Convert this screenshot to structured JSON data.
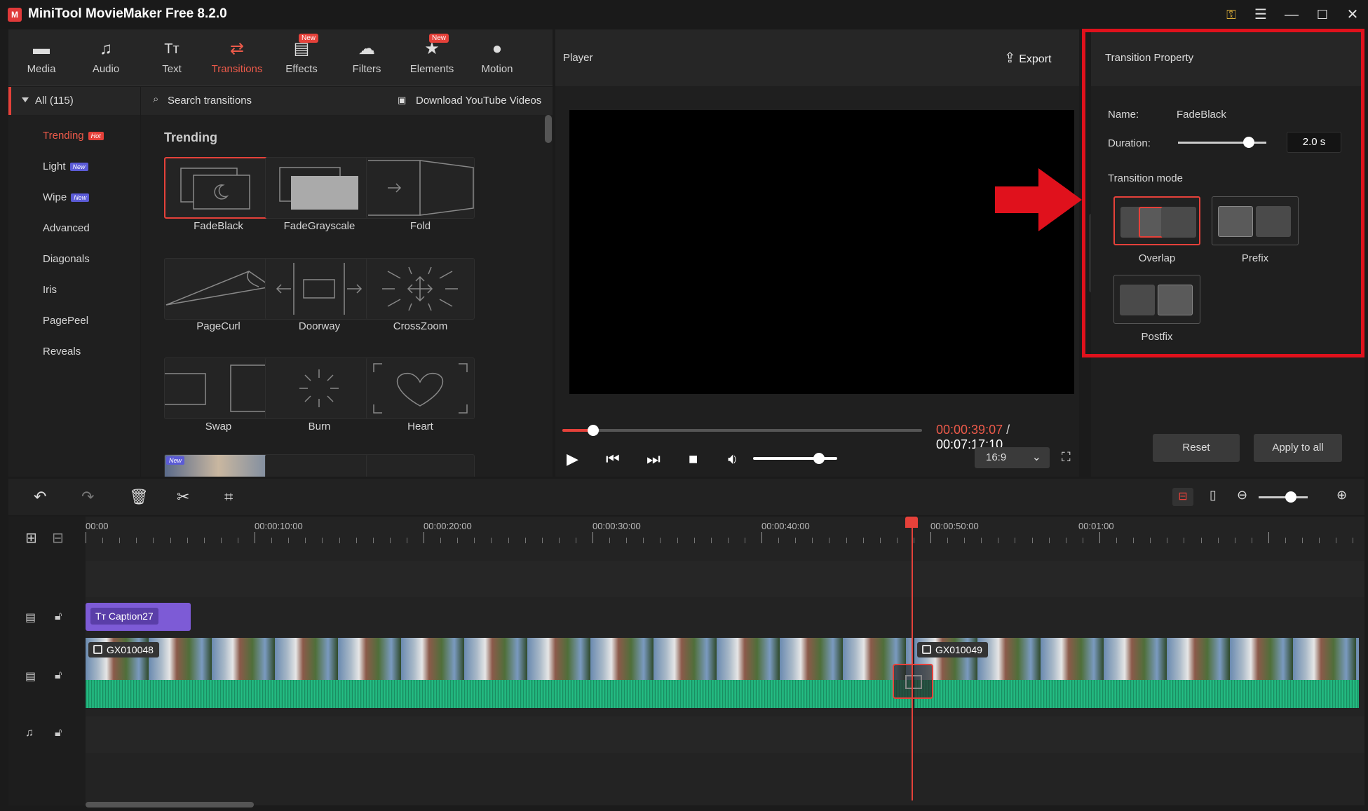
{
  "window": {
    "title": "MiniTool MovieMaker Free 8.2.0",
    "logo": "M"
  },
  "titlebar_icons": [
    "key-icon",
    "menu-icon",
    "minimize-icon",
    "maximize-icon",
    "close-icon"
  ],
  "toolbar": {
    "items": [
      {
        "label": "Media",
        "icon": "folder-icon"
      },
      {
        "label": "Audio",
        "icon": "music-note-icon"
      },
      {
        "label": "Text",
        "icon": "text-icon"
      },
      {
        "label": "Transitions",
        "icon": "transitions-icon",
        "active": true
      },
      {
        "label": "Effects",
        "icon": "effects-icon",
        "badge": "New"
      },
      {
        "label": "Filters",
        "icon": "filters-icon"
      },
      {
        "label": "Elements",
        "icon": "elements-icon",
        "badge": "New"
      },
      {
        "label": "Motion",
        "icon": "motion-icon"
      }
    ]
  },
  "categories": {
    "all_label": "All (115)",
    "items": [
      {
        "label": "Trending",
        "tag": "Hot",
        "active": true
      },
      {
        "label": "Light",
        "tag": "New"
      },
      {
        "label": "Wipe",
        "tag": "New"
      },
      {
        "label": "Advanced"
      },
      {
        "label": "Diagonals"
      },
      {
        "label": "Iris"
      },
      {
        "label": "PagePeel"
      },
      {
        "label": "Reveals"
      }
    ]
  },
  "transitions": {
    "search_placeholder": "Search transitions",
    "download_label": "Download YouTube Videos",
    "section_title": "Trending",
    "items": [
      "FadeBlack",
      "FadeGrayscale",
      "Fold",
      "PageCurl",
      "Doorway",
      "CrossZoom",
      "Swap",
      "Burn",
      "Heart"
    ],
    "partial_badge": "New"
  },
  "player": {
    "title": "Player",
    "export_label": "Export",
    "current_time": "00:00:39:07",
    "separator": " / ",
    "total_time": "00:07:17:10",
    "progress": 0.085,
    "volume": 0.78,
    "aspect_ratio": "16:9"
  },
  "property": {
    "title": "Transition Property",
    "name_label": "Name:",
    "name_value": "FadeBlack",
    "duration_label": "Duration:",
    "duration_value": "2.0 s",
    "duration_level": 0.8,
    "mode_label": "Transition mode",
    "modes": [
      {
        "label": "Overlap",
        "selected": true
      },
      {
        "label": "Prefix"
      },
      {
        "label": "Postfix"
      }
    ],
    "reset_label": "Reset",
    "apply_all_label": "Apply to all"
  },
  "timeline": {
    "ruler": [
      "00:00",
      "00:00:10:00",
      "00:00:20:00",
      "00:00:30:00",
      "00:00:40:00",
      "00:00:50:00",
      "00:01:00"
    ],
    "caption_clip": "Caption27",
    "video_clips": [
      "GX010048",
      "GX010049"
    ],
    "zoom_level": 0.65
  },
  "colors": {
    "accent": "#e5413a",
    "highlight_frame": "#e0111c",
    "waveform": "#20b07a",
    "caption": "#7d5bd6"
  }
}
